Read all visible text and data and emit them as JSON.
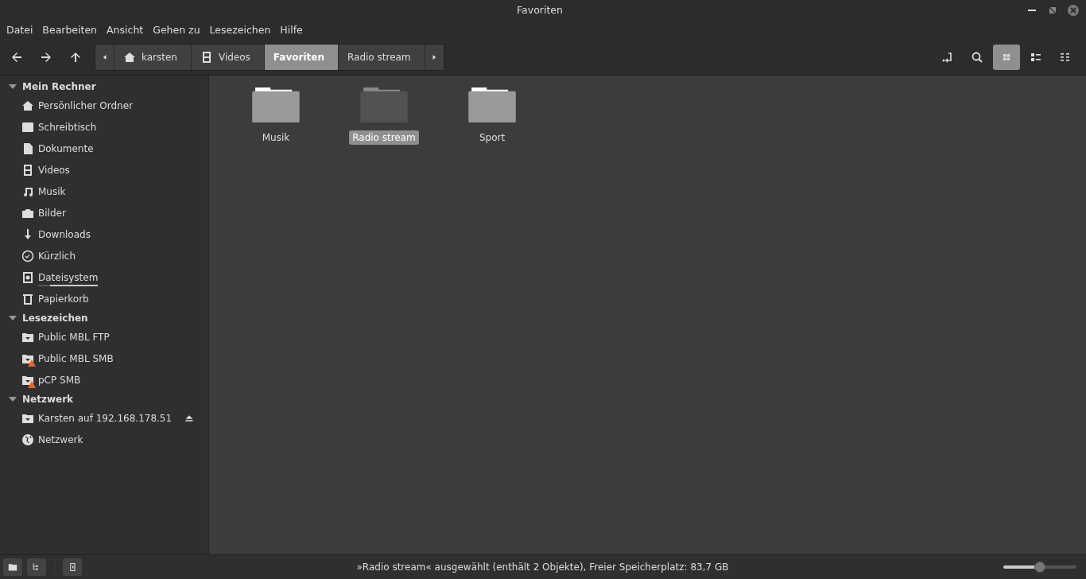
{
  "window": {
    "title": "Favoriten"
  },
  "menu": [
    "Datei",
    "Bearbeiten",
    "Ansicht",
    "Gehen zu",
    "Lesezeichen",
    "Hilfe"
  ],
  "path": [
    {
      "label": "karsten",
      "kind": "home",
      "selected": false
    },
    {
      "label": "Videos",
      "kind": "film",
      "selected": false
    },
    {
      "label": "Favoriten",
      "kind": "plain",
      "selected": true
    },
    {
      "label": "Radio stream",
      "kind": "plain",
      "selected": false
    }
  ],
  "views": [
    {
      "kind": "icons",
      "selected": true
    },
    {
      "kind": "list",
      "selected": false
    },
    {
      "kind": "compact",
      "selected": false
    }
  ],
  "sidebar": [
    {
      "title": "Mein Rechner",
      "expanded": true,
      "items": [
        {
          "label": "Persönlicher Ordner",
          "kind": "home"
        },
        {
          "label": "Schreibtisch",
          "kind": "desktop"
        },
        {
          "label": "Dokumente",
          "kind": "document"
        },
        {
          "label": "Videos",
          "kind": "film"
        },
        {
          "label": "Musik",
          "kind": "music"
        },
        {
          "label": "Bilder",
          "kind": "camera"
        },
        {
          "label": "Downloads",
          "kind": "download"
        },
        {
          "label": "Kürzlich",
          "kind": "clock"
        },
        {
          "label": "Dateisystem",
          "kind": "disk",
          "level": 0.2
        },
        {
          "label": "Papierkorb",
          "kind": "trash"
        }
      ]
    },
    {
      "title": "Lesezeichen",
      "expanded": true,
      "items": [
        {
          "label": "Public MBL FTP",
          "kind": "share",
          "warning": false
        },
        {
          "label": "Public MBL SMB",
          "kind": "share",
          "warning": true
        },
        {
          "label": "pCP SMB",
          "kind": "share",
          "warning": true
        }
      ]
    },
    {
      "title": "Netzwerk",
      "expanded": true,
      "items": [
        {
          "label": "Karsten auf 192.168.178.51",
          "kind": "share",
          "ejectable": true
        },
        {
          "label": "Netzwerk",
          "kind": "globe"
        }
      ]
    }
  ],
  "files": [
    {
      "name": "Musik",
      "selected": false
    },
    {
      "name": "Radio stream",
      "selected": true
    },
    {
      "name": "Sport",
      "selected": false
    }
  ],
  "status_bar": {
    "text": "»Radio stream« ausgewählt (enthält 2 Objekte), Freier Speicherplatz: 83,7 GB",
    "zoom": {
      "level": 0.5
    }
  }
}
